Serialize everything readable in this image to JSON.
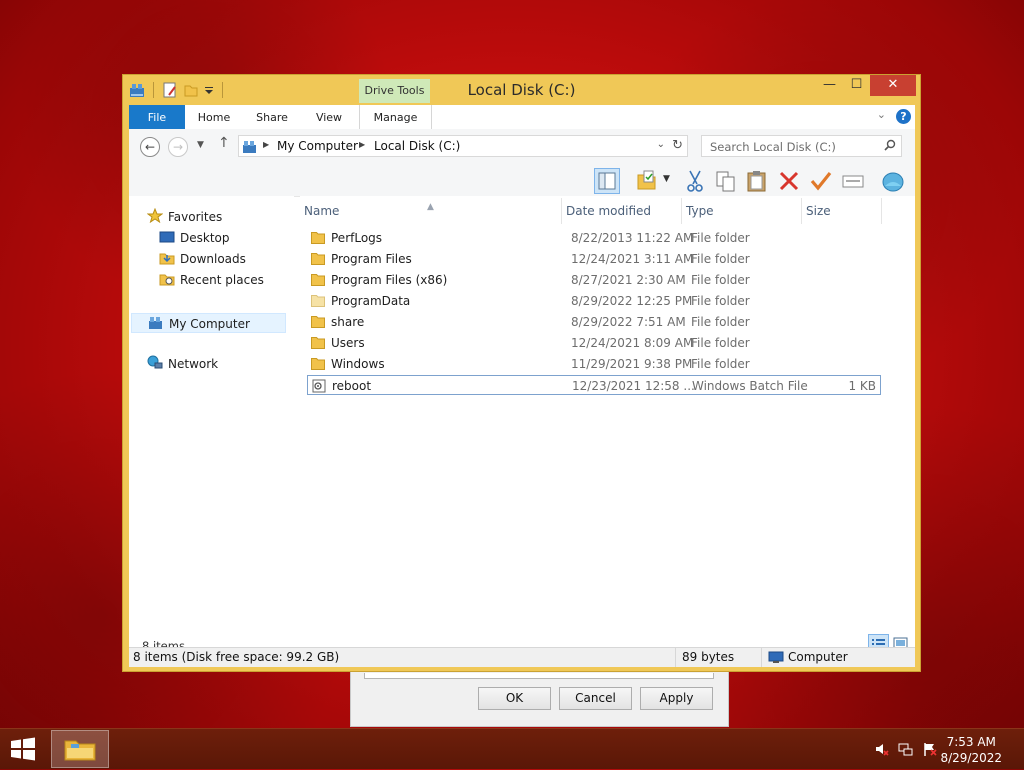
{
  "window": {
    "title": "Local Disk (C:)",
    "minimize_glyph": "—",
    "maximize_glyph": "☐",
    "close_glyph": "✕"
  },
  "ribbon": {
    "contextual_group": "Drive Tools",
    "tabs": [
      "File",
      "Home",
      "Share",
      "View",
      "Manage"
    ],
    "active_contextual_tab": "Manage",
    "help_glyph": "?"
  },
  "address": {
    "back_glyph": "←",
    "forward_glyph": "→",
    "up_glyph": "↑",
    "breadcrumbs": [
      "My Computer",
      "Local Disk (C:)"
    ],
    "search_placeholder": "Search Local Disk (C:)"
  },
  "toolbar": {
    "icons": [
      "preview-pane-icon",
      "properties-icon",
      "cut-icon",
      "copy-icon",
      "paste-icon",
      "delete-icon",
      "select-icon",
      "rename-icon",
      "globe-icon"
    ]
  },
  "nav_pane": {
    "favorites_label": "Favorites",
    "favorites": [
      "Desktop",
      "Downloads",
      "Recent places"
    ],
    "computer_label": "My Computer",
    "network_label": "Network"
  },
  "columns": {
    "name": "Name",
    "date": "Date modified",
    "type": "Type",
    "size": "Size"
  },
  "files": [
    {
      "name": "PerfLogs",
      "date": "8/22/2013 11:22 AM",
      "type": "File folder",
      "size": "",
      "kind": "folder"
    },
    {
      "name": "Program Files",
      "date": "12/24/2021 3:11 AM",
      "type": "File folder",
      "size": "",
      "kind": "folder"
    },
    {
      "name": "Program Files (x86)",
      "date": "8/27/2021 2:30 AM",
      "type": "File folder",
      "size": "",
      "kind": "folder"
    },
    {
      "name": "ProgramData",
      "date": "8/29/2022 12:25 PM",
      "type": "File folder",
      "size": "",
      "kind": "folder-hidden"
    },
    {
      "name": "share",
      "date": "8/29/2022 7:51 AM",
      "type": "File folder",
      "size": "",
      "kind": "folder"
    },
    {
      "name": "Users",
      "date": "12/24/2021 8:09 AM",
      "type": "File folder",
      "size": "",
      "kind": "folder"
    },
    {
      "name": "Windows",
      "date": "11/29/2021 9:38 PM",
      "type": "File folder",
      "size": "",
      "kind": "folder"
    },
    {
      "name": "reboot",
      "date": "12/23/2021 12:58 ...",
      "type": "Windows Batch File",
      "size": "1 KB",
      "kind": "batch"
    }
  ],
  "status": {
    "items_count": "8 items",
    "summary": "8 items (Disk free space: 99.2 GB)",
    "bytes": "89 bytes",
    "location": "Computer"
  },
  "background_dialog": {
    "ok": "OK",
    "cancel": "Cancel",
    "apply": "Apply"
  },
  "taskbar": {
    "time": "7:53 AM",
    "date": "8/29/2022"
  },
  "colors": {
    "titlebar": "#f0c857",
    "file_tab": "#1979ca",
    "drive_tools": "#cfe9b8",
    "close_button": "#c84031",
    "desktop": "#c41010",
    "taskbar": "#5e1808"
  }
}
